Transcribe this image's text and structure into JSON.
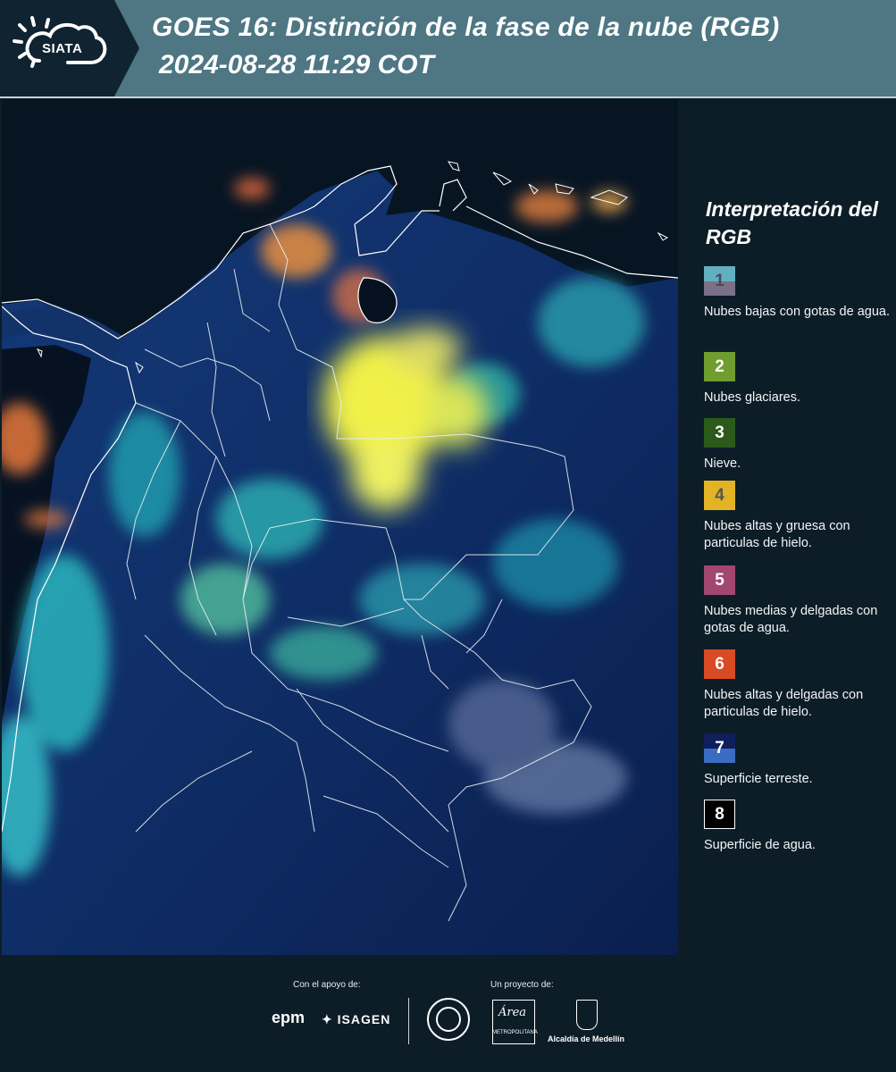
{
  "header": {
    "logo": "SIATA",
    "title": "GOES 16: Distinción de la fase de la nube (RGB)",
    "subtitle": "2024-08-28 11:29 COT"
  },
  "legend": {
    "title": "Interpretación del RGB",
    "items": [
      {
        "number": "1",
        "text": "Nubes bajas con gotas de agua.",
        "color_top": "#61afc1",
        "color_bottom": "#7b7087",
        "number_color": "#4a4a58"
      },
      {
        "number": "2",
        "text": "Nubes glaciares.",
        "color": "#6f9e2e",
        "number_color": "#ffffff"
      },
      {
        "number": "3",
        "text": "Nieve.",
        "color": "#2c5a1a",
        "number_color": "#ffffff"
      },
      {
        "number": "4",
        "text": "Nubes altas y gruesa con particulas de hielo.",
        "color": "#e2b324",
        "number_color": "#555555"
      },
      {
        "number": "5",
        "text": "Nubes medias y delgadas con gotas de agua.",
        "color": "#a2476f",
        "number_color": "#ffffff"
      },
      {
        "number": "6",
        "text": "Nubes altas y delgadas con particulas de hielo.",
        "color": "#d84b25",
        "number_color": "#ffffff"
      },
      {
        "number": "7",
        "text": "Superficie terreste.",
        "color_top": "#0e1f5c",
        "color_bottom": "#3b6cc3",
        "number_color": "#ffffff"
      },
      {
        "number": "8",
        "text": "Superficie de agua.",
        "color": "#000000",
        "border": "#ffffff",
        "number_color": "#ffffff"
      }
    ]
  },
  "footer": {
    "support_label": "Con el apoyo de:",
    "project_label": "Un proyecto de:",
    "epm": "epm",
    "isagen": "ISAGEN",
    "amva_name": "METROPOLITANA",
    "amva_script": "Área",
    "alcaldia": "Alcaldía de Medellín"
  },
  "colors": {
    "header_bg": "#4e7683",
    "panel_bg": "#0d1d28",
    "ocean": "#06111e",
    "land": "#0f2a60"
  }
}
